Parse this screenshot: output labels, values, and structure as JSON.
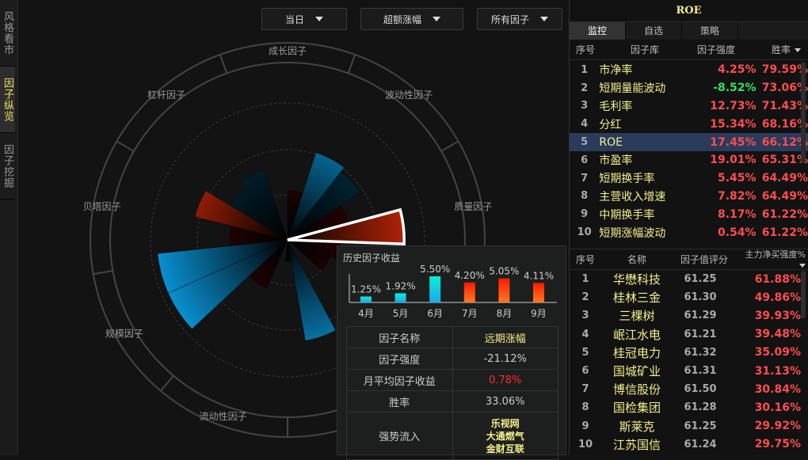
{
  "sidebar": {
    "items": [
      {
        "label": "风格看市",
        "active": false
      },
      {
        "label": "因子纵览",
        "active": true
      },
      {
        "label": "因子挖掘",
        "active": false
      }
    ]
  },
  "toolbar": {
    "period": "当日",
    "metric": "超额涨幅",
    "factor_filter": "所有因子"
  },
  "chart_data": {
    "type": "polar-bar",
    "categories": [
      {
        "label": "成长因子",
        "angle": 0
      },
      {
        "label": "波动性因子",
        "angle": 40
      },
      {
        "label": "质量因子",
        "angle": 80
      },
      {
        "label": "流动性因子",
        "angle": 200
      },
      {
        "label": "规模因子",
        "angle": 240
      },
      {
        "label": "贝塔因子",
        "angle": 280
      },
      {
        "label": "杠杆因子",
        "angle": 320
      }
    ],
    "wedges": [
      {
        "start": 0,
        "end": 18,
        "value": 28,
        "sign": "positive",
        "emphasis": false
      },
      {
        "start": 18,
        "end": 38,
        "value": 52,
        "sign": "negative",
        "emphasis": true
      },
      {
        "start": 38,
        "end": 57,
        "value": 49,
        "sign": "negative",
        "emphasis": false
      },
      {
        "start": 57,
        "end": 75,
        "value": 36,
        "sign": "positive",
        "emphasis": false
      },
      {
        "start": 75,
        "end": 92,
        "value": 66,
        "sign": "positive",
        "emphasis": true,
        "selected": true
      },
      {
        "start": 92,
        "end": 112,
        "value": 30,
        "sign": "positive",
        "emphasis": false
      },
      {
        "start": 112,
        "end": 132,
        "value": 26,
        "sign": "positive",
        "emphasis": false
      },
      {
        "start": 152,
        "end": 170,
        "value": 58,
        "sign": "negative",
        "emphasis": true
      },
      {
        "start": 170,
        "end": 186,
        "value": 12,
        "sign": "positive",
        "emphasis": false
      },
      {
        "start": 203,
        "end": 226,
        "value": 30,
        "sign": "positive",
        "emphasis": false
      },
      {
        "start": 227,
        "end": 246,
        "value": 74,
        "sign": "negative",
        "emphasis": true
      },
      {
        "start": 246,
        "end": 264,
        "value": 74,
        "sign": "negative",
        "emphasis": true
      },
      {
        "start": 264,
        "end": 284,
        "value": 33,
        "sign": "positive",
        "emphasis": false
      },
      {
        "start": 284,
        "end": 301,
        "value": 54,
        "sign": "positive",
        "emphasis": true
      },
      {
        "start": 301,
        "end": 321,
        "value": 38,
        "sign": "negative",
        "emphasis": false
      },
      {
        "start": 321,
        "end": 341,
        "value": 42,
        "sign": "negative",
        "emphasis": false
      }
    ],
    "radial_max": 100,
    "colors": {
      "positive": "#d42a0a",
      "negative": "#0a9be0",
      "positive_dim": "#4a0606",
      "negative_dim": "#00384f"
    }
  },
  "popup": {
    "title": "历史因子收益",
    "chart_data": {
      "type": "bar",
      "categories": [
        "4月",
        "5月",
        "6月",
        "7月",
        "8月",
        "9月"
      ],
      "values": [
        1.25,
        1.92,
        5.5,
        4.2,
        5.05,
        4.11
      ],
      "labels": [
        "1.25%",
        "1.92%",
        "5.50%",
        "4.20%",
        "5.05%",
        "4.11%"
      ],
      "colors": [
        "cyan",
        "cyan",
        "cyan",
        "red",
        "red",
        "red"
      ]
    },
    "rows": [
      {
        "label": "因子名称",
        "value": "远期涨幅",
        "style": "yellow"
      },
      {
        "label": "因子强度",
        "value": "-21.12%",
        "style": ""
      },
      {
        "label": "月平均因子收益",
        "value": "0.78%",
        "style": "red"
      },
      {
        "label": "胜率",
        "value": "33.06%",
        "style": ""
      }
    ],
    "inflow_label": "强势流入",
    "inflow": [
      "乐视网",
      "大通燃气",
      "金财互联"
    ]
  },
  "right": {
    "title": "ROE",
    "tabs": [
      "监控",
      "自选",
      "策略"
    ],
    "factor_header": {
      "idx": "序号",
      "name": "因子库",
      "strength": "因子强度",
      "win": "胜率"
    },
    "factors": [
      {
        "idx": "1",
        "name": "市净率",
        "strength": "4.25%",
        "win": "79.59%",
        "neg": false
      },
      {
        "idx": "2",
        "name": "短期量能波动",
        "strength": "-8.52%",
        "win": "73.06%",
        "neg": true
      },
      {
        "idx": "3",
        "name": "毛利率",
        "strength": "12.73%",
        "win": "71.43%",
        "neg": false
      },
      {
        "idx": "4",
        "name": "分红",
        "strength": "15.34%",
        "win": "68.16%",
        "neg": false
      },
      {
        "idx": "5",
        "name": "ROE",
        "strength": "17.45%",
        "win": "66.12%",
        "neg": false,
        "selected": true
      },
      {
        "idx": "6",
        "name": "市盈率",
        "strength": "19.01%",
        "win": "65.31%",
        "neg": false
      },
      {
        "idx": "7",
        "name": "短期换手率",
        "strength": "5.45%",
        "win": "64.49%",
        "neg": false
      },
      {
        "idx": "8",
        "name": "主营收入增速",
        "strength": "7.82%",
        "win": "64.49%",
        "neg": false
      },
      {
        "idx": "9",
        "name": "中期换手率",
        "strength": "8.17%",
        "win": "61.22%",
        "neg": false
      },
      {
        "idx": "10",
        "name": "短期涨幅波动",
        "strength": "0.54%",
        "win": "61.22%",
        "neg": false
      }
    ],
    "stock_header": {
      "idx": "序号",
      "name": "名称",
      "score": "因子值评分",
      "strength": "主力净买强度%"
    },
    "stocks": [
      {
        "idx": "1",
        "name": "华懋科技",
        "score": "61.25",
        "strength": "61.88%"
      },
      {
        "idx": "2",
        "name": "桂林三金",
        "score": "61.30",
        "strength": "49.86%"
      },
      {
        "idx": "3",
        "name": "三棵树",
        "score": "61.29",
        "strength": "39.93%"
      },
      {
        "idx": "4",
        "name": "岷江水电",
        "score": "61.21",
        "strength": "39.48%"
      },
      {
        "idx": "5",
        "name": "桂冠电力",
        "score": "61.32",
        "strength": "35.09%"
      },
      {
        "idx": "6",
        "name": "国城矿业",
        "score": "61.31",
        "strength": "31.13%"
      },
      {
        "idx": "7",
        "name": "博信股份",
        "score": "61.50",
        "strength": "30.84%"
      },
      {
        "idx": "8",
        "name": "国检集团",
        "score": "61.28",
        "strength": "30.16%"
      },
      {
        "idx": "9",
        "name": "斯莱克",
        "score": "61.25",
        "strength": "29.92%"
      },
      {
        "idx": "10",
        "name": "江苏国信",
        "score": "61.24",
        "strength": "29.75%"
      }
    ]
  }
}
